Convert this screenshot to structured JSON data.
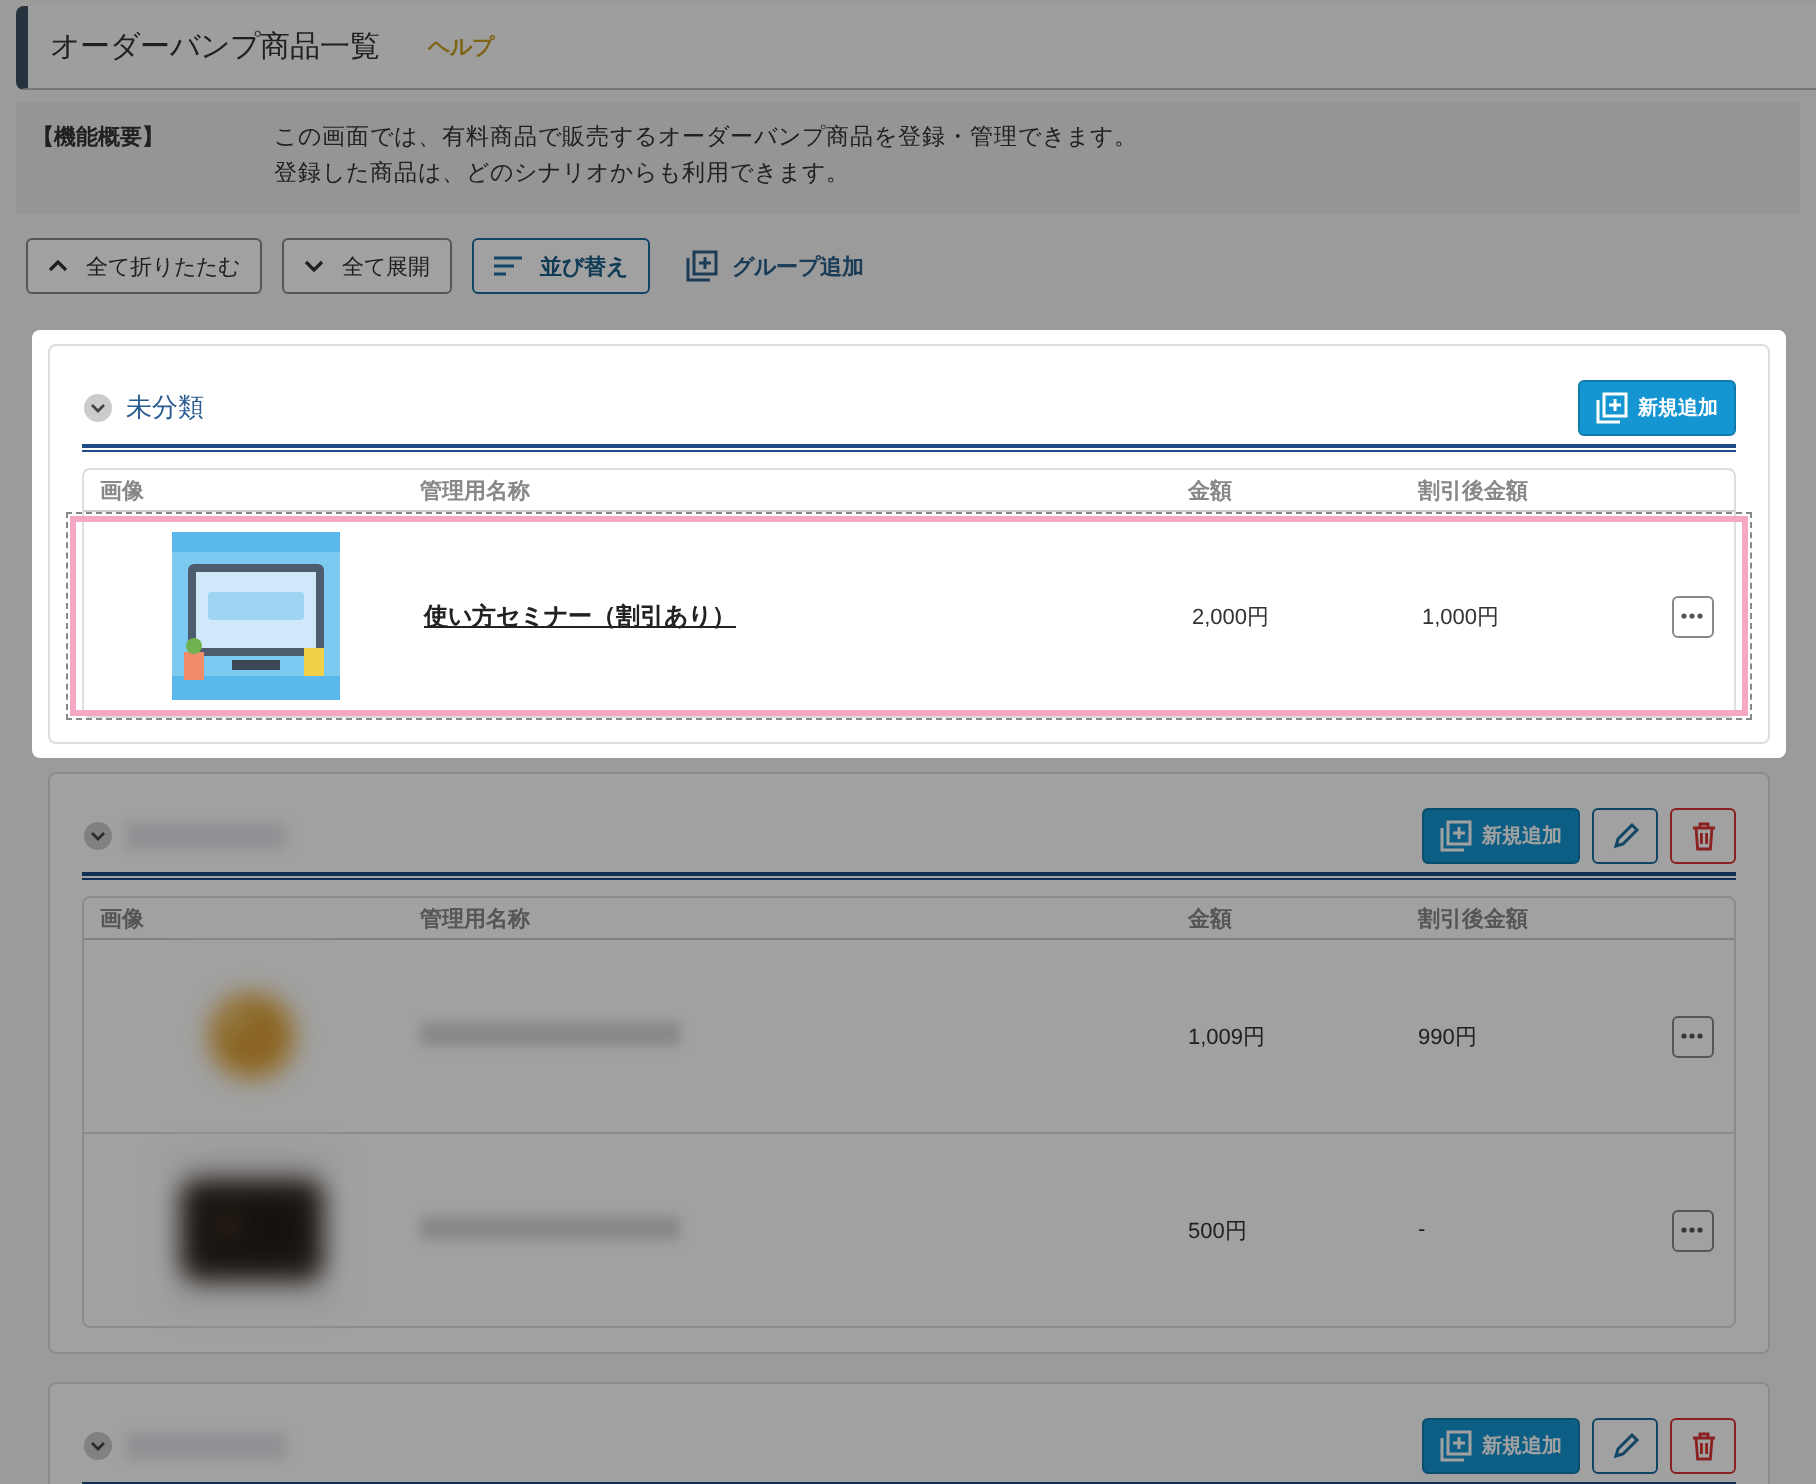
{
  "page": {
    "title": "オーダーバンプ商品一覧",
    "help_link": "ヘルプ"
  },
  "overview": {
    "label": "【機能概要】",
    "lines": [
      "この画面では、有料商品で販売するオーダーバンプ商品を登録・管理できます。",
      "登録した商品は、どのシナリオからも利用できます。"
    ]
  },
  "toolbar": [
    {
      "kind": "collapse",
      "label": "全て折りたたむ"
    },
    {
      "kind": "expand",
      "label": "全て展開"
    },
    {
      "kind": "sort",
      "label": "並び替え"
    },
    {
      "kind": "add-group",
      "label": "グループ追加"
    }
  ],
  "groups": [
    {
      "title": "未分類",
      "redacted": false,
      "highlighted": true,
      "editable": false,
      "add_button": "新規追加",
      "columns": [
        "画像",
        "管理用名称",
        "金額",
        "割引後金額"
      ],
      "rows": [
        {
          "kind": "picture",
          "name": "使い方セミナー（割引あり）",
          "blurred": false,
          "selected": true,
          "price": "2,000円",
          "discounted": "1,000円"
        }
      ]
    },
    {
      "redacted": true,
      "highlighted": false,
      "editable": true,
      "add_button": "新規追加",
      "columns": [
        "画像",
        "管理用名称",
        "金額",
        "割引後金額"
      ],
      "rows": [
        {
          "kind": "picture",
          "blurred": true,
          "selected": false,
          "price": "1,009円",
          "discounted": "990円"
        },
        {
          "kind": "picture",
          "blurred": true,
          "selected": false,
          "price": "500円",
          "discounted": "-"
        }
      ]
    },
    {
      "redacted": true,
      "highlighted": false,
      "editable": true,
      "add_button": "新規追加"
    }
  ]
}
